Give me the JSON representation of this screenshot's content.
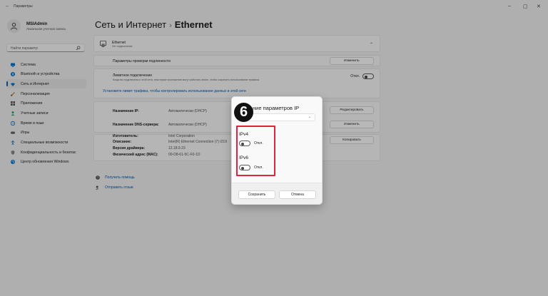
{
  "window": {
    "title": "Параметры",
    "back_glyph": "←",
    "controls": [
      "–",
      "▢",
      "✕"
    ]
  },
  "user": {
    "name": "MSIAdmin",
    "account_type": "Локальная учетная запись"
  },
  "search": {
    "placeholder": "Найти параметр"
  },
  "sidebar": {
    "items": [
      {
        "label": "Система",
        "icon": "monitor-icon",
        "color": "#0078d4"
      },
      {
        "label": "Bluetooth и устройства",
        "icon": "bluetooth-icon",
        "color": "#0078d4"
      },
      {
        "label": "Сеть и Интернет",
        "icon": "wifi-icon",
        "color": "#0078d4",
        "active": true
      },
      {
        "label": "Персонализация",
        "icon": "brush-icon",
        "color": "#c87a2a"
      },
      {
        "label": "Приложения",
        "icon": "apps-icon",
        "color": "#555555"
      },
      {
        "label": "Учетные записи",
        "icon": "person-icon",
        "color": "#2f9e5e"
      },
      {
        "label": "Время и язык",
        "icon": "globe-clock-icon",
        "color": "#0078d4"
      },
      {
        "label": "Игры",
        "icon": "gamepad-icon",
        "color": "#666666"
      },
      {
        "label": "Специальные возможности",
        "icon": "accessibility-icon",
        "color": "#0067c0"
      },
      {
        "label": "Конфиденциальность и безопас",
        "icon": "shield-icon",
        "color": "#888888"
      },
      {
        "label": "Центр обновления Windows",
        "icon": "update-icon",
        "color": "#0078d4"
      }
    ]
  },
  "breadcrumb": {
    "parent": "Сеть и Интернет",
    "separator": "›",
    "current": "Ethernet"
  },
  "ethernet_card": {
    "title": "Ethernet",
    "subtitle": "Нет подключения"
  },
  "settings": {
    "auth_label": "Параметры проверки подлинности",
    "auth_button": "Изменить",
    "metered_label": "Лимитное подключение",
    "metered_desc": "Когда вы подключены к этой сети, некоторые приложения могут работать иначе, чтобы сократить использование трафика.",
    "metered_state": "Откл.",
    "data_limit_link": "Установите лимит трафика, чтобы контролировать использование данных в этой сети",
    "ip_assign_label": "Назначение IP:",
    "ip_assign_value": "Автоматически (DHCP)",
    "ip_assign_button": "Редактировать",
    "dns_label": "Назначение DNS-сервера:",
    "dns_value": "Автоматически (DHCP)",
    "dns_button": "Изменить",
    "manufacturer_label": "Изготовитель:",
    "manufacturer_value": "Intel Corporation",
    "description_label": "Описание:",
    "description_value": "Intel(R) Ethernet Connection (7) I219",
    "driver_label": "Версия драйвера:",
    "driver_value": "12.18.9.23",
    "mac_label": "Физический адрес (MAC):",
    "mac_value": "00-D8-61-5C-F0-1D",
    "copy_button": "Копировать"
  },
  "help": {
    "get_help": "Получить помощь",
    "feedback": "Отправить отзыв"
  },
  "dialog": {
    "title": "ние параметров IP",
    "step_number": "6",
    "ipv4_label": "IPv4",
    "ipv4_state": "Откл.",
    "ipv6_label": "IPv6",
    "ipv6_state": "Откл.",
    "save_button": "Сохранить",
    "cancel_button": "Отмена",
    "highlight_color": "#e0243a"
  }
}
